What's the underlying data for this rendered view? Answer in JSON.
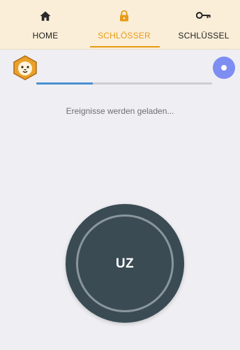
{
  "tabs": [
    {
      "label": "HOME",
      "icon": "home-icon",
      "active": false
    },
    {
      "label": "SCHLÖSSER",
      "icon": "lock-icon",
      "active": true
    },
    {
      "label": "SCHLÜSSEL",
      "icon": "key-icon",
      "active": false
    }
  ],
  "colors": {
    "accent": "#e79b16",
    "topbar_bg": "#fbeed8",
    "page_bg": "#efeff3",
    "progress": "#4a8fcf",
    "lock_button": "#3a4b53",
    "status_dot": "#7d8df2"
  },
  "profile": {
    "avatar_icon": "lion-avatar-icon"
  },
  "status": {
    "icon": "status-dot-icon"
  },
  "progress": {
    "value": 0.32
  },
  "message": "Ereignisse werden geladen...",
  "lock_button": {
    "label": "UZ"
  }
}
